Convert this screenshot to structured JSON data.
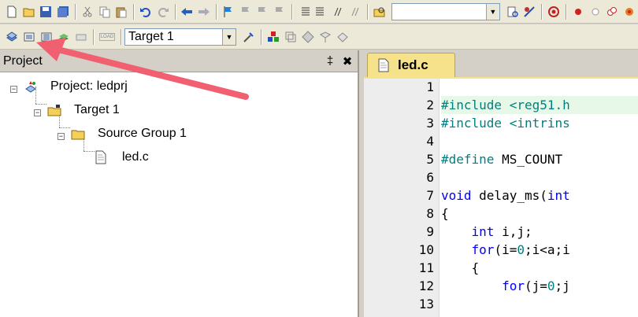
{
  "toolbar1": {
    "target_combo_value": "",
    "icons": [
      "new-file-icon",
      "open-file-icon",
      "save-icon",
      "save-all-icon",
      "cut-icon",
      "copy-icon",
      "paste-icon",
      "undo-icon",
      "redo-icon",
      "nav-back-icon",
      "nav-forward-icon",
      "bookmark-icon",
      "prev-bookmark-icon",
      "next-bookmark-icon",
      "clear-bookmarks-icon",
      "indent-icon",
      "unindent-icon",
      "comment-icon",
      "uncomment-icon",
      "find-in-files-icon",
      "find-icon",
      "incremental-find-icon",
      "debug-icon",
      "breakpoint-icon",
      "disable-breakpoint-icon",
      "disable-all-breakpoints-icon",
      "kill-breakpoints-icon"
    ]
  },
  "toolbar2": {
    "load_label": "LOAD",
    "target_select": "Target 1"
  },
  "project": {
    "title": "Project",
    "pin": "‡",
    "close": "✖",
    "tree": {
      "root": "Project: ledprj",
      "target": "Target 1",
      "group": "Source Group 1",
      "file": "led.c"
    }
  },
  "editor": {
    "tab_label": "led.c",
    "line_numbers": [
      "1",
      "2",
      "3",
      "4",
      "5",
      "6",
      "7",
      "8",
      "9",
      "10",
      "11",
      "12",
      "13"
    ],
    "lines": [
      {
        "parts": []
      },
      {
        "parts": [
          {
            "t": "#include <reg51.h",
            "c": "pp"
          }
        ]
      },
      {
        "parts": [
          {
            "t": "#include <intrins",
            "c": "pp"
          }
        ]
      },
      {
        "parts": []
      },
      {
        "parts": [
          {
            "t": "#define ",
            "c": "pp"
          },
          {
            "t": "MS_COUNT",
            "c": ""
          }
        ]
      },
      {
        "parts": []
      },
      {
        "parts": [
          {
            "t": "void",
            "c": "kw"
          },
          {
            "t": " delay_ms(",
            "c": ""
          },
          {
            "t": "int",
            "c": "kw"
          }
        ]
      },
      {
        "parts": [
          {
            "t": "{",
            "c": ""
          }
        ]
      },
      {
        "parts": [
          {
            "t": "    ",
            "c": ""
          },
          {
            "t": "int",
            "c": "kw"
          },
          {
            "t": " i,j;",
            "c": ""
          }
        ]
      },
      {
        "parts": [
          {
            "t": "    ",
            "c": ""
          },
          {
            "t": "for",
            "c": "kw"
          },
          {
            "t": "(i=",
            "c": ""
          },
          {
            "t": "0",
            "c": "num"
          },
          {
            "t": ";i<a;i",
            "c": ""
          }
        ]
      },
      {
        "parts": [
          {
            "t": "    {",
            "c": ""
          }
        ]
      },
      {
        "parts": [
          {
            "t": "        ",
            "c": ""
          },
          {
            "t": "for",
            "c": "kw"
          },
          {
            "t": "(j=",
            "c": ""
          },
          {
            "t": "0",
            "c": "num"
          },
          {
            "t": ";j",
            "c": ""
          }
        ]
      },
      {
        "parts": []
      }
    ]
  },
  "colors": {
    "arrow": "#f06070",
    "tab_bg": "#f6e28a",
    "highlight_line": "#e8f8e8"
  }
}
